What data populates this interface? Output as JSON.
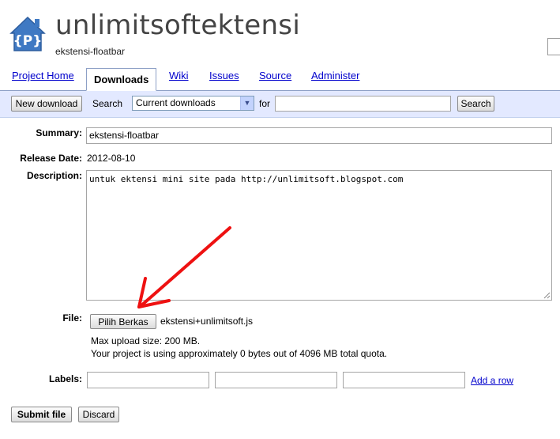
{
  "header": {
    "project_name": "unlimitsoftektensi",
    "project_summary": "ekstensi-floatbar",
    "logo_letter": "{P}"
  },
  "tabs": [
    {
      "label": "Project Home",
      "active": false
    },
    {
      "label": "Downloads",
      "active": true
    },
    {
      "label": "Wiki",
      "active": false
    },
    {
      "label": "Issues",
      "active": false
    },
    {
      "label": "Source",
      "active": false
    },
    {
      "label": "Administer",
      "active": false
    }
  ],
  "toolbar": {
    "new_download_label": "New download",
    "search_label": "Search",
    "search_scope": "Current downloads",
    "for_label": "for",
    "search_query": "",
    "search_button_label": "Search"
  },
  "form": {
    "summary_label": "Summary:",
    "summary_value": "ekstensi-floatbar",
    "release_date_label": "Release Date:",
    "release_date_value": "2012-08-10",
    "description_label": "Description:",
    "description_value": "untuk ektensi mini site pada http://unlimitsoft.blogspot.com",
    "file_label": "File:",
    "choose_file_label": "Pilih Berkas",
    "file_name": "ekstensi+unlimitsoft.js",
    "max_upload_text": "Max upload size: 200 MB.",
    "quota_text": "Your project is using approximately 0 bytes out of 4096 MB total quota.",
    "labels_label": "Labels:",
    "labels_values": [
      "",
      "",
      ""
    ],
    "add_row_label": "Add a row",
    "submit_label": "Submit file",
    "discard_label": "Discard"
  },
  "colors": {
    "annotation_arrow": "#ee1111",
    "logo_blue": "#4a80c8",
    "toolbar_bg": "#e3e9ff",
    "link": "#0000cc"
  }
}
